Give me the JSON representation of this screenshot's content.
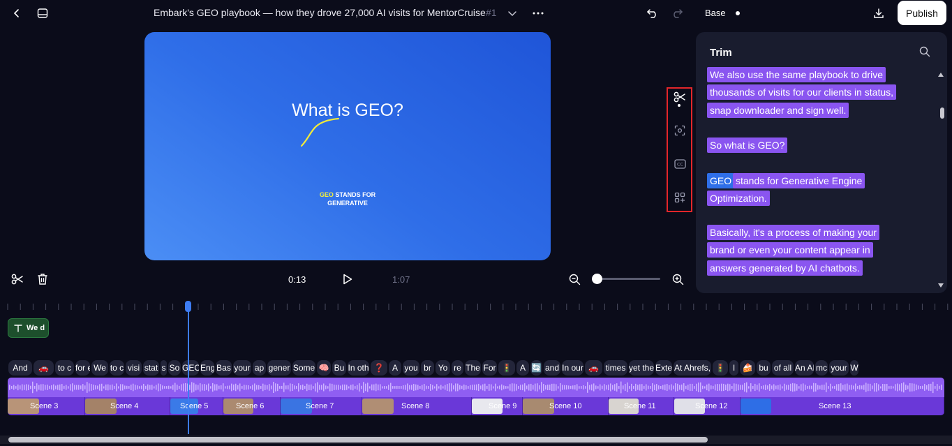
{
  "header": {
    "title": "Embark's GEO playbook — how they drove 27,000 AI visits for MentorCruise",
    "number": "#1",
    "version_label": "Base",
    "publish_label": "Publish"
  },
  "preview": {
    "heading": "What is GEO?",
    "caption_highlight": "GEO",
    "caption_line1_rest": " STANDS FOR",
    "caption_line2": "GENERATIVE"
  },
  "playback": {
    "current_time": "0:13",
    "total_time": "1:07"
  },
  "panel": {
    "title": "Trim",
    "lines": [
      "We also use the same playbook to drive",
      "thousands of visits for our clients in status,",
      "snap downloader and sign well.",
      "So what is GEO?",
      "GEO",
      "stands for Generative Engine",
      "Optimization.",
      "Basically, it's a process of making your",
      "brand or even your content appear in",
      "answers generated by AI chatbots."
    ]
  },
  "timeline": {
    "text_clip_label": "We d",
    "words": [
      "And",
      "🚗",
      "to c",
      "for e",
      "We",
      "to c",
      "visi",
      "stat",
      "s",
      "So",
      "GEO",
      "Eng",
      "Bas",
      "your",
      "ap",
      "gener",
      "Some",
      "🧠",
      "Bu",
      "In oth",
      "❓",
      "A",
      "you",
      "br",
      "Yo",
      "re",
      "The",
      "For",
      "🚦",
      "A",
      "🔄",
      "and",
      "In our",
      "🚗",
      "times",
      "yet the",
      "Exte",
      "At Ahrefs,",
      "🚦",
      "I",
      "🍰",
      "bu",
      "of all",
      "An AI",
      "mc",
      "your",
      "W"
    ],
    "scenes": [
      "Scene 3",
      "Scene 4",
      "Scene 5",
      "Scene 6",
      "Scene 7",
      "Scene 8",
      "Scene 9",
      "Scene 10",
      "Scene 11",
      "Scene 12",
      "Scene 13"
    ]
  },
  "colors": {
    "accent_blue": "#3d7cf2",
    "highlight_purple": "#8a55f0",
    "highlight_box": "#e3262a"
  }
}
